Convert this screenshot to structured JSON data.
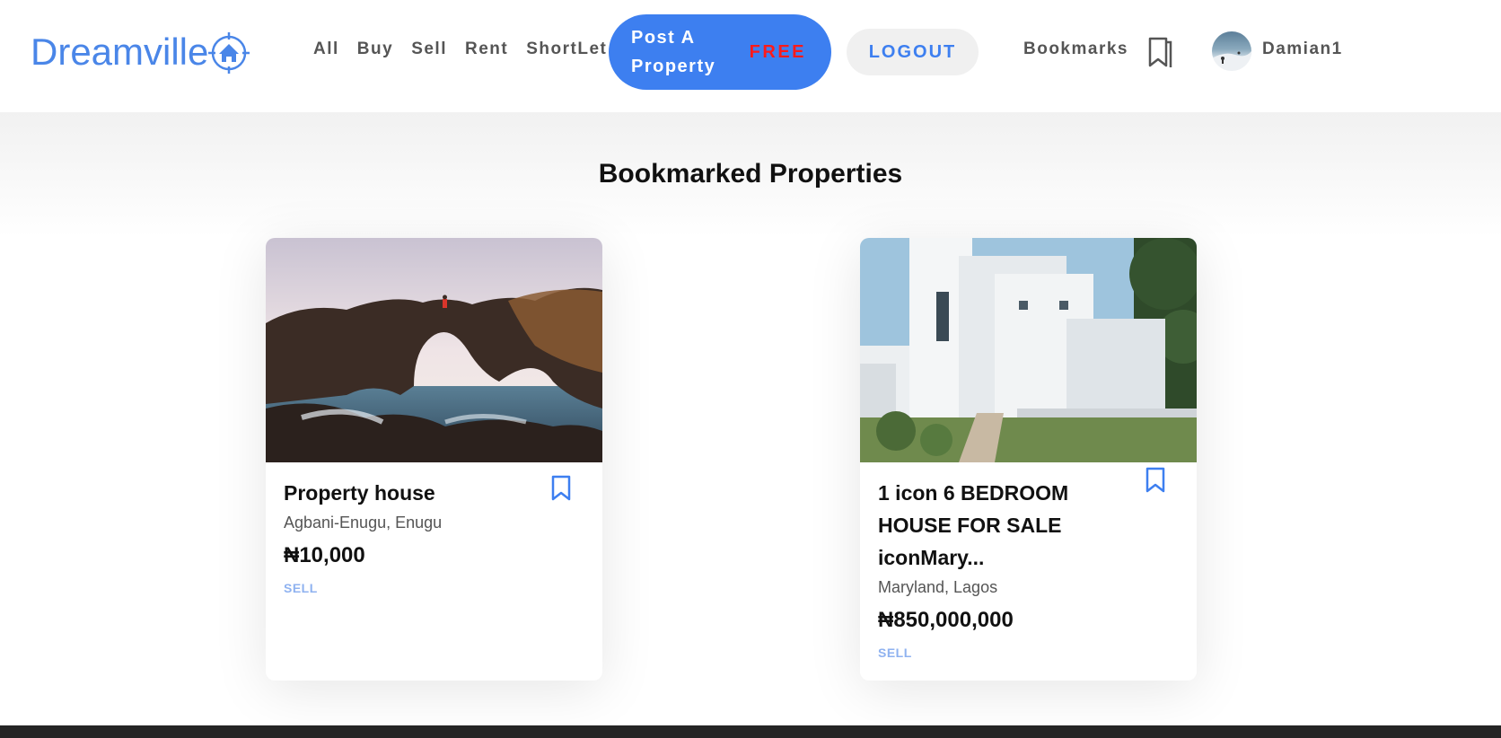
{
  "header": {
    "logo_text": "Dreamville",
    "nav": [
      "All",
      "Buy",
      "Sell",
      "Rent",
      "ShortLet"
    ],
    "post_label": "Post A Property",
    "post_free": "FREE",
    "logout": "LOGOUT",
    "bookmarks": "Bookmarks",
    "username": "Damian1"
  },
  "main": {
    "title": "Bookmarked Properties",
    "cards": [
      {
        "title": "Property house",
        "location": "Agbani-Enugu, Enugu",
        "price": "₦10,000",
        "type": "SELL"
      },
      {
        "title": "1 icon 6 BEDROOM HOUSE FOR SALE iconMary...",
        "location": "Maryland, Lagos",
        "price": "₦850,000,000",
        "type": "SELL"
      }
    ]
  },
  "colors": {
    "brand": "#4a86e8",
    "primary_button": "#3d7ff0",
    "free_text": "#ff1a1a",
    "badge": "#8fb2f0",
    "footer": "#252525"
  }
}
